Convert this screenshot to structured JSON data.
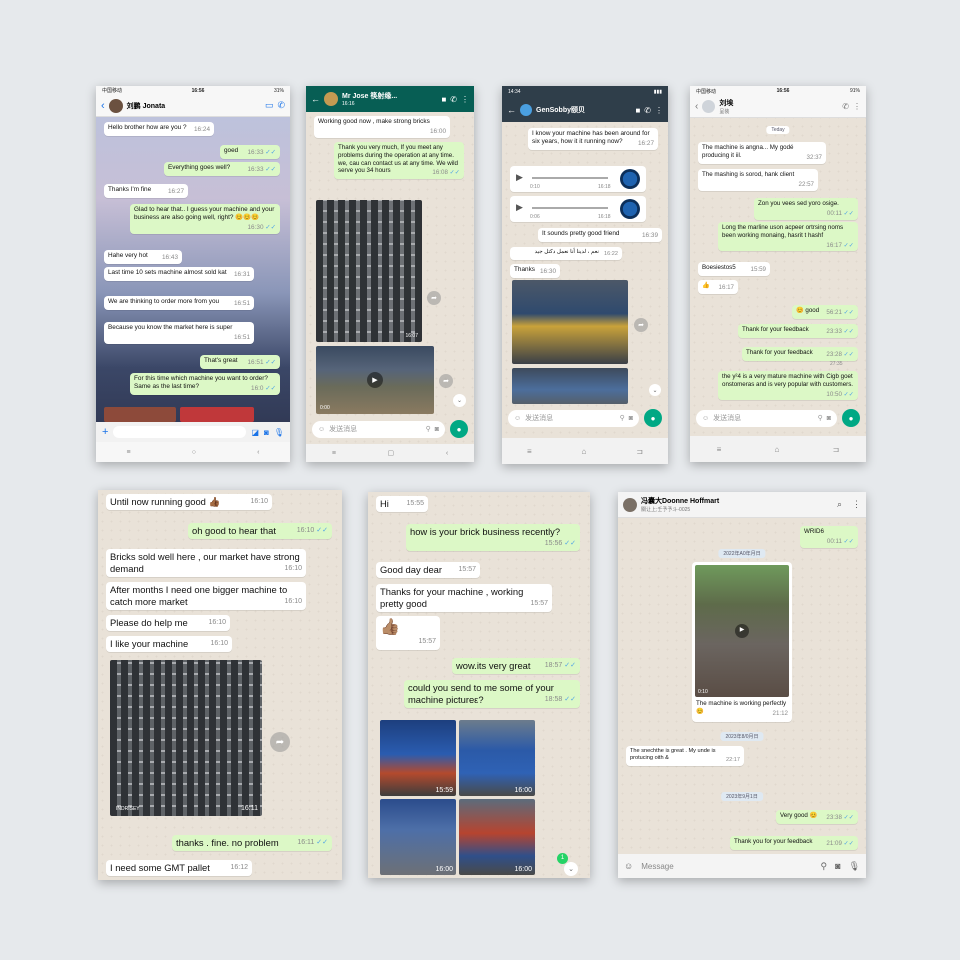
{
  "s1": {
    "status": {
      "left": "中国移动 ",
      "time": "16:56",
      "right": "31%"
    },
    "contact": "刘鹏 Jonata",
    "messages": [
      {
        "dir": "in",
        "text": "Hello brother how are you ?",
        "time": "16:24"
      },
      {
        "dir": "out",
        "text": "goed",
        "time": "16:33"
      },
      {
        "dir": "out",
        "text": "Everything goes well?",
        "time": "16:33"
      },
      {
        "dir": "in",
        "text": "Thanks I'm fine",
        "time": "16:27"
      },
      {
        "dir": "out",
        "text": "Glad to hear that.. I guess your machine and your business are also going well, right? 😊😊😊",
        "time": "16:30"
      },
      {
        "dir": "in",
        "text": "Hahe very hot",
        "time": "16:43"
      },
      {
        "dir": "in",
        "text": "Last time 10 sets machine almost sold kat",
        "time": "16:31"
      },
      {
        "dir": "in",
        "text": "We are thinking to order more from you",
        "time": "16:51"
      },
      {
        "dir": "in",
        "text": "Because you know the market here is super",
        "time": "16:51"
      },
      {
        "dir": "out",
        "text": "That's great",
        "time": "16:51"
      },
      {
        "dir": "out",
        "text": "For this time which machine you want to order? Same as the last time?",
        "time": "16:0"
      }
    ]
  },
  "s2": {
    "contact": "Mr Jose 筷射缘...",
    "sub": "16:16",
    "messages": [
      {
        "dir": "in",
        "text": "Working good now , make strong bricks",
        "time": "16:00"
      },
      {
        "dir": "out",
        "text": "Thank you very much, If you meet any problems during the operation at any time. we, cau can contact us at any time. We wild serve you 34 hours",
        "time": "16:08"
      }
    ],
    "img_time": "16:07",
    "video_time": "0:00",
    "placeholder": "发送消息"
  },
  "s3": {
    "status": {
      "time": "14:34"
    },
    "contact": "GenSobby颐贝",
    "messages": [
      {
        "dir": "in",
        "text": "I know your machine has been around for six years, how it it running now?",
        "time": "16:27"
      },
      {
        "dir": "in",
        "text": "It sounds pretty good friend",
        "time": "16:39"
      },
      {
        "dir": "in",
        "text": "نعم ، لدينا أنا نعمل دكتل جيد",
        "time": "16:22"
      },
      {
        "dir": "in",
        "text": "Thanks",
        "time": "16:30"
      }
    ],
    "voices": [
      {
        "dur": "0:10",
        "time": "16:18"
      },
      {
        "dur": "0:06",
        "time": "16:18"
      }
    ],
    "placeholder": "发送消息"
  },
  "s4": {
    "status": {
      "left": "中国移动 ",
      "time": "16:56",
      "right": "91%"
    },
    "contact": "刘埃",
    "sub": "呈装",
    "date": "Teday",
    "messages": [
      {
        "dir": "in",
        "text": "The machine is angna... My godé producing it iil.",
        "time": "32:37"
      },
      {
        "dir": "in",
        "text": "The mashing is sorod, hank client",
        "time": "22:57"
      },
      {
        "dir": "out",
        "text": "Zon you vees sed yoro osigə.",
        "time": "00:11"
      },
      {
        "dir": "out",
        "text": "Long the marline uson acpeer ortrsing noms been working monaing, hasrit t hashf",
        "time": "16:17"
      },
      {
        "dir": "in",
        "text": "Boesiestos5",
        "time": "15:59"
      },
      {
        "dir": "in",
        "text": "👍",
        "time": "16:17"
      },
      {
        "dir": "out",
        "text": "😊 good",
        "time": "56:21"
      },
      {
        "dir": "out",
        "text": "Thank for your feedback",
        "time": "23:33"
      },
      {
        "dir": "out",
        "text": "Thank for your feedback",
        "time": "23:28"
      },
      {
        "dir": "out",
        "text": "the y²4 is a very mature machine with Cigb goet onstomeras and is very popular with customers.",
        "time": "10:50"
      }
    ],
    "extra_time": "27:35",
    "placeholder": "发送消息"
  },
  "s5": {
    "messages": [
      {
        "dir": "in",
        "text": "Until now running good 👍🏾",
        "time": "16:10"
      },
      {
        "dir": "out",
        "text": "oh good to hear that",
        "time": "16:10"
      },
      {
        "dir": "in",
        "text": "Bricks sold well here , our market have strong demand",
        "time": "16:10"
      },
      {
        "dir": "in",
        "text": "After months I need one bigger machine to catch more market",
        "time": "16:10"
      },
      {
        "dir": "in",
        "text": "Please do help me",
        "time": "16:10"
      },
      {
        "dir": "in",
        "text": "I like your machine",
        "time": "16:10"
      },
      {
        "dir": "out",
        "text": "thanks . fine. no problem",
        "time": "16:11"
      },
      {
        "dir": "in",
        "text": "I need some GMT pallet",
        "time": "16:12"
      }
    ],
    "img_time": "16:11",
    "img_watermark": "INDRISEY"
  },
  "s6": {
    "messages": [
      {
        "dir": "in",
        "text": "Hi",
        "time": "15:55"
      },
      {
        "dir": "out",
        "text": "how is your brick business recently?",
        "time": "15:56"
      },
      {
        "dir": "in",
        "text": "Good day dear",
        "time": "15:57"
      },
      {
        "dir": "in",
        "text": "Thanks for your machine , working pretty good",
        "time": "15:57"
      },
      {
        "dir": "in",
        "text": "👍🏽",
        "time": "15:57"
      },
      {
        "dir": "out",
        "text": "wow.its very great",
        "time": "18:57"
      },
      {
        "dir": "out",
        "text": "could you send to me some of your machine pictureε?",
        "time": "18:58"
      }
    ],
    "photo_times": [
      "15:59",
      "16:00",
      "16:00",
      "16:00"
    ],
    "badge": "1"
  },
  "s7": {
    "contact": "冯囊大Doonne Hoffmart",
    "sub": "關让上;壬予予斗-0025",
    "top_msg": {
      "text": "WRID6",
      "time": "00:11"
    },
    "dates": [
      "2022年A0年月日",
      "2023年8/0月日",
      "2023年9月1日"
    ],
    "video": {
      "dur": "0:10",
      "caption": "The machine is working perfectly 😊",
      "time": "21:12"
    },
    "messages": [
      {
        "dir": "in",
        "text": "The snechthe is great . My unde is protucing oith &",
        "time": "22:17"
      },
      {
        "dir": "out",
        "text": "Very good 😊",
        "time": "23:38"
      },
      {
        "dir": "out",
        "text": "Thank you for your feedback",
        "time": "21:09"
      }
    ],
    "placeholder": "Message"
  }
}
